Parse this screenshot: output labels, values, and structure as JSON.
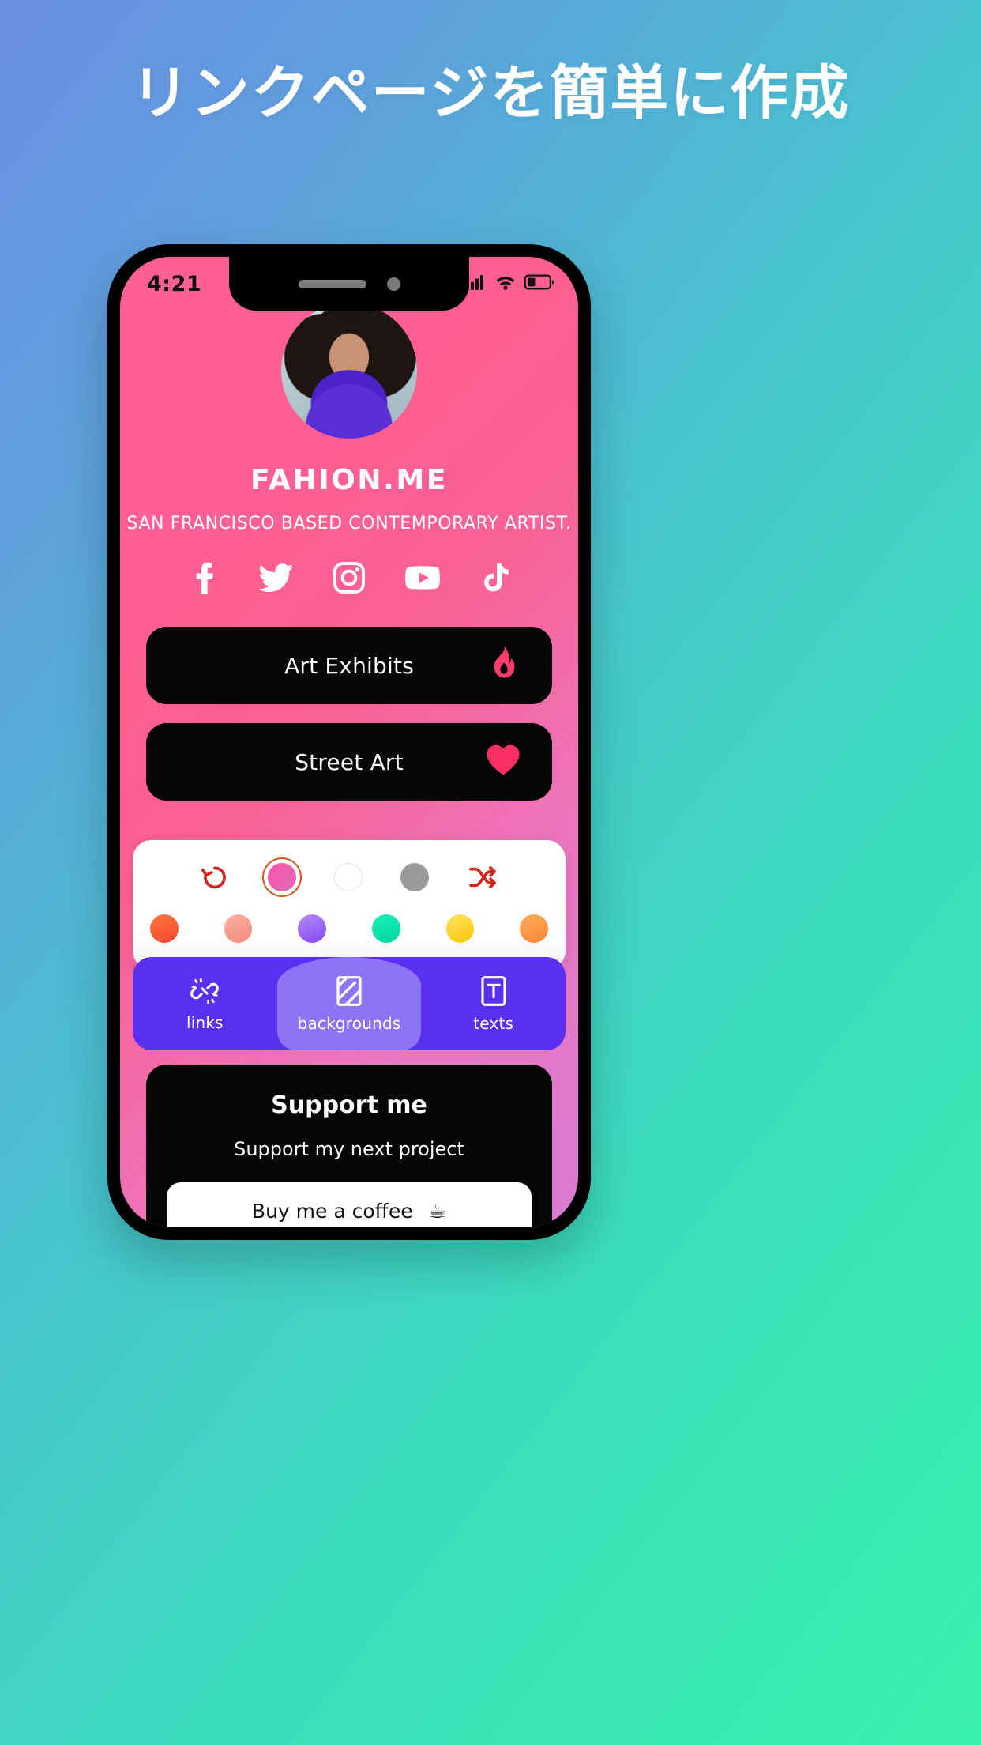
{
  "headline": "リンクページを簡単に作成",
  "colors": {
    "page_gradient_start": "#6a8fe3",
    "page_gradient_end": "#3af0ad",
    "phone_screen_start": "#ff5f92",
    "phone_screen_end": "#d97bd4",
    "accent_purple": "#5b2ff0",
    "accent_purple_active": "#8d74f7",
    "accent_red": "#d2261f",
    "card_black": "#050505"
  },
  "phone": {
    "status_bar": {
      "time": "4:21",
      "signal_icon": "cellular-signal-icon",
      "wifi_icon": "wifi-icon",
      "battery_icon": "battery-low-icon"
    },
    "profile": {
      "avatar": "profile-avatar",
      "name": "FAHION.ME",
      "bio": "SAN FRANCISCO BASED CONTEMPORARY ARTIST."
    },
    "socials": [
      {
        "name": "facebook-icon",
        "label": "Facebook"
      },
      {
        "name": "twitter-icon",
        "label": "Twitter"
      },
      {
        "name": "instagram-icon",
        "label": "Instagram"
      },
      {
        "name": "youtube-icon",
        "label": "YouTube"
      },
      {
        "name": "tiktok-icon",
        "label": "TikTok"
      }
    ],
    "links": [
      {
        "label": "Art Exhibits",
        "emoji": "🔥",
        "emoji_name": "fire-icon"
      },
      {
        "label": "Street Art",
        "emoji": "❤️",
        "emoji_name": "heart-icon"
      }
    ],
    "editor": {
      "tools": [
        {
          "name": "undo-icon",
          "type": "icon",
          "color": "#d2261f"
        },
        {
          "name": "selected-gradient-swatch",
          "type": "swatch",
          "color": "#ff52a8",
          "selected": true
        },
        {
          "name": "white-swatch",
          "type": "swatch",
          "color": "#ffffff",
          "selected": false
        },
        {
          "name": "grey-swatch",
          "type": "swatch",
          "color": "#9b9b9b",
          "selected": false
        },
        {
          "name": "shuffle-icon",
          "type": "icon",
          "color": "#d2261f"
        }
      ],
      "palette": [
        {
          "name": "orange-red-swatch",
          "color": "#fb5a32"
        },
        {
          "name": "salmon-swatch",
          "color": "#f79c8c"
        },
        {
          "name": "purple-swatch",
          "color": "#9d6bf5"
        },
        {
          "name": "teal-swatch",
          "color": "#09e3ab"
        },
        {
          "name": "yellow-swatch",
          "color": "#fbcc08"
        },
        {
          "name": "orange-swatch",
          "color": "#fb9544"
        }
      ],
      "tabs": [
        {
          "label": "links",
          "icon": "broken-link-icon",
          "active": false
        },
        {
          "label": "backgrounds",
          "icon": "diagonal-stripes-icon",
          "active": true
        },
        {
          "label": "texts",
          "icon": "text-box-icon",
          "active": false
        }
      ]
    },
    "support": {
      "title": "Support me",
      "subtitle": "Support my next project",
      "button_label": "Buy me a coffee",
      "button_emoji": "☕",
      "button_emoji_name": "coffee-icon"
    }
  }
}
